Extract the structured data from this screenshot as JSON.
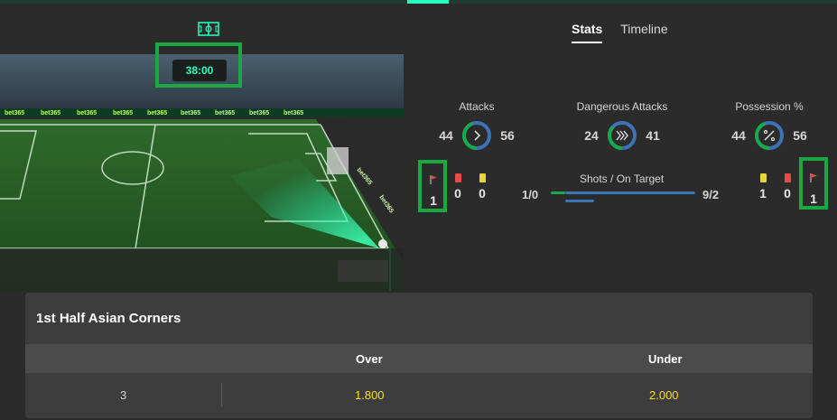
{
  "clock": "38:00",
  "tabs": [
    {
      "label": "Stats",
      "active": true
    },
    {
      "label": "Timeline",
      "active": false
    }
  ],
  "stats": {
    "attacks": {
      "title": "Attacks",
      "home": "44",
      "away": "56"
    },
    "dangerous_attacks": {
      "title": "Dangerous Attacks",
      "home": "24",
      "away": "41"
    },
    "possession": {
      "title": "Possession %",
      "home": "44",
      "away": "56"
    }
  },
  "home_counts": {
    "corners": "1",
    "red_cards": "0",
    "yellow_cards": "0"
  },
  "away_counts": {
    "yellow_cards": "1",
    "red_cards": "0",
    "corners": "1"
  },
  "shots": {
    "title": "Shots / On Target",
    "home": "1/0",
    "away": "9/2"
  },
  "market": {
    "title": "1st Half Asian Corners",
    "headers": {
      "over": "Over",
      "under": "Under"
    },
    "row": {
      "line": "3",
      "over": "1.800",
      "under": "2.000"
    }
  },
  "colors": {
    "home": "#1aa94a",
    "away": "#3d73b5",
    "accent": "#26ffbe",
    "odds": "#ffdf1b",
    "red_card": "#e84848",
    "yellow_card": "#e6d53a",
    "highlight_box": "#1aa940"
  },
  "icons": [
    "pitch-icon",
    "corner-flag-icon",
    "red-card-icon",
    "yellow-card-icon",
    "chevron-right-icon",
    "triple-chevron-icon",
    "percent-icon"
  ]
}
